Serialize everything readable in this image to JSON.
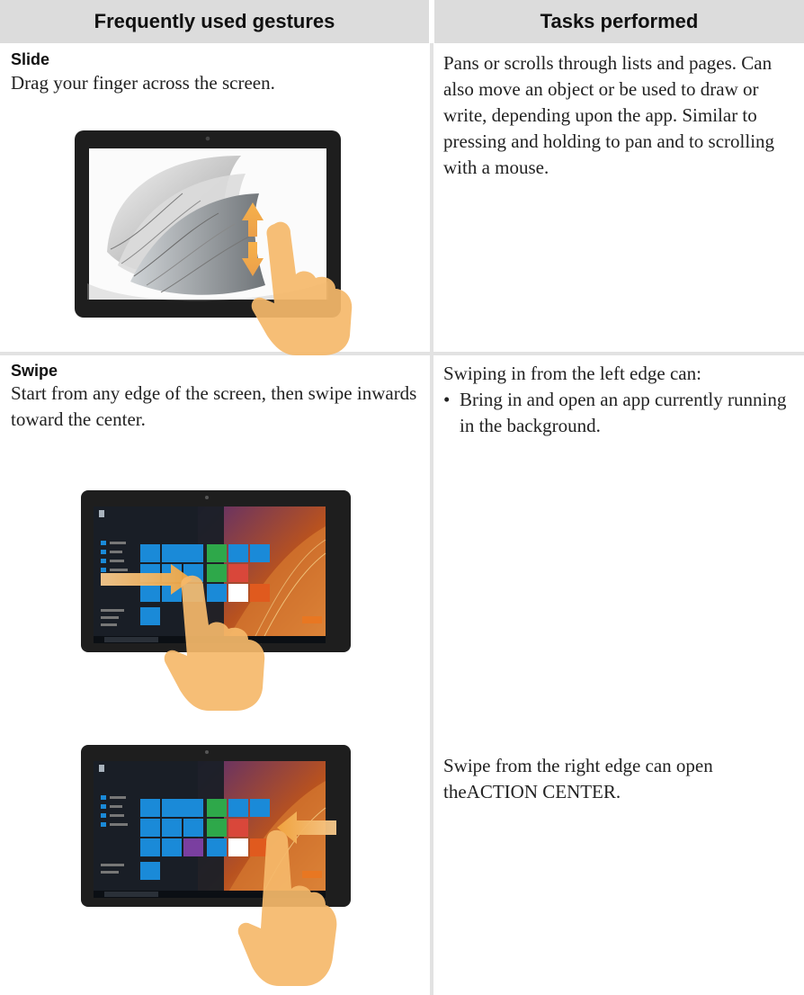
{
  "headers": {
    "gestures": "Frequently used gestures",
    "tasks": "Tasks performed"
  },
  "rows": [
    {
      "gesture": "Slide",
      "instruction": "Drag your finger across the screen.",
      "task": "Pans or scrolls through lists and pages. Can also move an object or be used to draw or write, depending upon the app. Similar to pressing and holding to pan and to scrolling with a mouse.",
      "illustration": "tablet-slide-illustration"
    },
    {
      "gesture": "Swipe",
      "instruction": "Start from any edge of the screen, then swipe inwards toward the center.",
      "task_intro": "Swiping in from the left edge can:",
      "task_bullets": [
        "Bring in and open an app currently running in the background."
      ],
      "task_right_edge": "Swipe from the right edge can open theACTION CENTER.",
      "illustrations": [
        "tablet-swipe-left-illustration",
        "tablet-swipe-right-illustration"
      ]
    }
  ],
  "colors": {
    "header_bg": "#dcdcdc",
    "divider": "#e2e2e2",
    "tablet_bezel": "#1e1e1e",
    "tile_blue": "#1a8ad8",
    "tile_green": "#2ea84a",
    "arrow_orange": "#f2a640",
    "finger": "#f5b86a"
  }
}
